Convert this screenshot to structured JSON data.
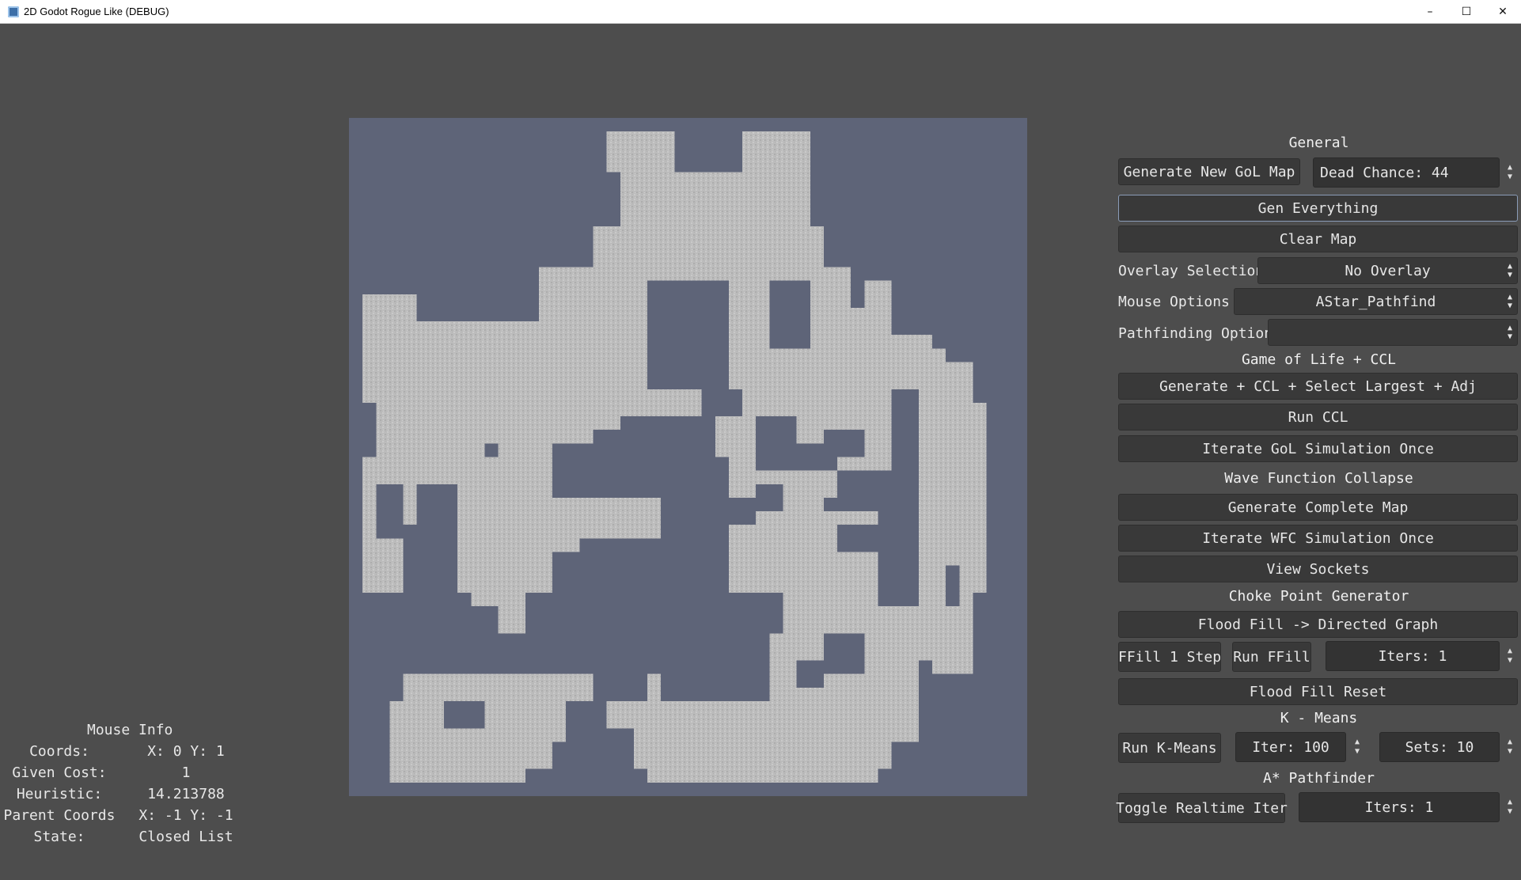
{
  "window": {
    "title": "2D Godot Rogue Like (DEBUG)",
    "controls": [
      "–",
      "☐",
      "✕"
    ]
  },
  "map": {
    "grid_size": 50,
    "floor_color": "#bdbdbd",
    "wall_color": "#5e6478"
  },
  "mouse_info": {
    "title": "Mouse Info",
    "rows": [
      {
        "label": "Coords:",
        "value": "X: 0 Y: 1"
      },
      {
        "label": "Given Cost:",
        "value": "1"
      },
      {
        "label": "Heuristic:",
        "value": "14.213788"
      },
      {
        "label": "Parent Coords",
        "value": "X: -1 Y: -1"
      },
      {
        "label": "State:",
        "value": "Closed List"
      }
    ]
  },
  "general": {
    "title": "General",
    "generate_gol_map": "Generate New GoL Map",
    "dead_chance": "Dead Chance: 44",
    "gen_everything": "Gen Everything",
    "clear_map": "Clear Map",
    "overlay_label": "Overlay Selection",
    "overlay_value": "No Overlay",
    "mouse_label": "Mouse Options",
    "mouse_value": "AStar_Pathfind",
    "pathfinding_label": "Pathfinding Option",
    "pathfinding_value": ""
  },
  "gol": {
    "title": "Game of Life + CCL",
    "gen_ccl": "Generate + CCL + Select Largest + Adj",
    "run_ccl": "Run CCL",
    "iterate_gol": "Iterate GoL Simulation Once"
  },
  "wfc": {
    "title": "Wave Function Collapse",
    "generate_complete": "Generate Complete Map",
    "iterate_wfc": "Iterate WFC Simulation Once",
    "view_sockets": "View Sockets"
  },
  "choke": {
    "title": "Choke Point Generator",
    "flood_fill_graph": "Flood Fill -> Directed Graph",
    "ffill_step": "FFill 1 Step",
    "run_ffill": "Run FFill",
    "iters": "Iters: 1",
    "flood_fill_reset": "Flood Fill Reset"
  },
  "kmeans": {
    "title": "K - Means",
    "run_kmeans": "Run K-Means",
    "iter": "Iter: 100",
    "sets": "Sets: 10"
  },
  "astar": {
    "title": "A* Pathfinder",
    "toggle_realtime": "Toggle Realtime Iter",
    "iters": "Iters: 1"
  }
}
